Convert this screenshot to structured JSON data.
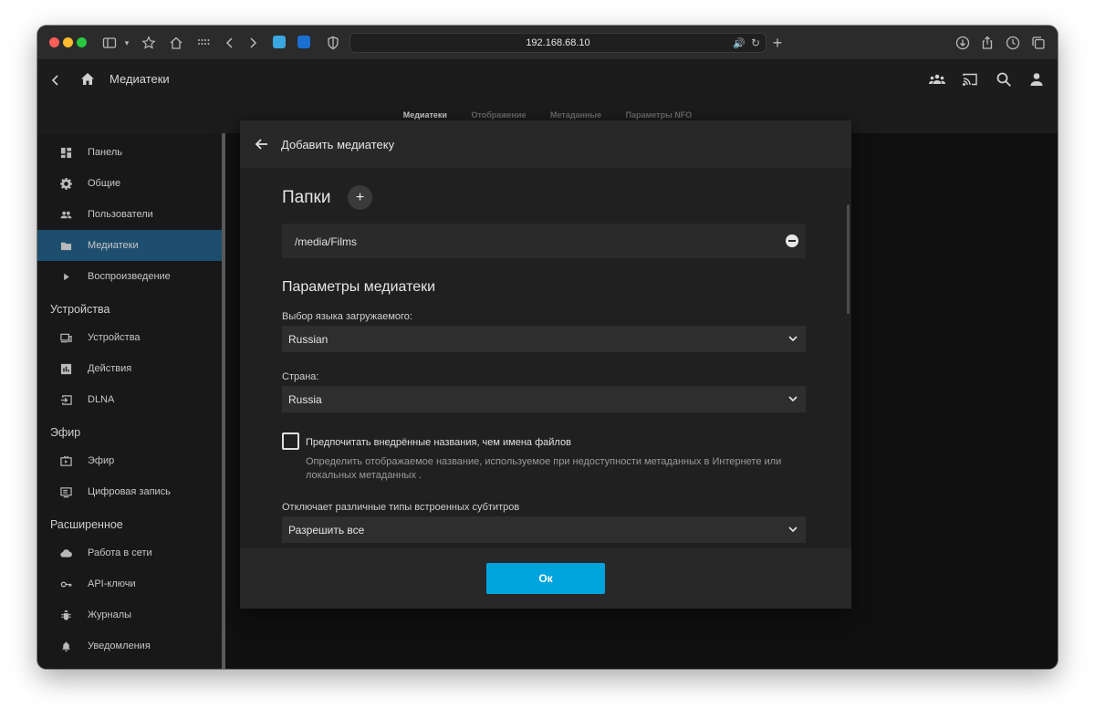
{
  "browser": {
    "url": "192.168.68.10"
  },
  "header": {
    "title": "Медиатеки",
    "tabs": [
      {
        "label": "Медиатеки",
        "active": true
      },
      {
        "label": "Отображение",
        "active": false
      },
      {
        "label": "Метаданные",
        "active": false
      },
      {
        "label": "Параметры NFO",
        "active": false
      }
    ]
  },
  "sidebar": {
    "items": [
      {
        "label": "Панель",
        "icon": "dashboard-icon"
      },
      {
        "label": "Общие",
        "icon": "gear-icon"
      },
      {
        "label": "Пользователи",
        "icon": "people-icon"
      },
      {
        "label": "Медиатеки",
        "icon": "folder-icon",
        "active": true
      },
      {
        "label": "Воспроизведение",
        "icon": "play-icon"
      }
    ],
    "sections": [
      {
        "title": "Устройства",
        "items": [
          {
            "label": "Устройства",
            "icon": "devices-icon"
          },
          {
            "label": "Действия",
            "icon": "activity-icon"
          },
          {
            "label": "DLNA",
            "icon": "input-icon"
          }
        ]
      },
      {
        "title": "Эфир",
        "items": [
          {
            "label": "Эфир",
            "icon": "live-tv-icon"
          },
          {
            "label": "Цифровая запись",
            "icon": "dvr-icon"
          }
        ]
      },
      {
        "title": "Расширенное",
        "items": [
          {
            "label": "Работа в сети",
            "icon": "cloud-icon"
          },
          {
            "label": "API-ключи",
            "icon": "key-icon"
          },
          {
            "label": "Журналы",
            "icon": "bug-icon"
          },
          {
            "label": "Уведомления",
            "icon": "bell-icon"
          }
        ]
      }
    ]
  },
  "dialog": {
    "title": "Добавить медиатеку",
    "folders_title": "Папки",
    "add_symbol": "+",
    "folder_path": "/media/Films",
    "section_title": "Параметры медиатеки",
    "language_label": "Выбор языка загружаемого:",
    "language_value": "Russian",
    "country_label": "Страна:",
    "country_value": "Russia",
    "checkbox_label": "Предпочитать внедрённые названия, чем имена файлов",
    "checkbox_checked": false,
    "checkbox_help": "Определить отображаемое название, используемое при недоступности метаданных в Интернете или локальных метаданных .",
    "subtitles_label": "Отключает различные типы встроенных субтитров",
    "subtitles_value": "Разрешить все",
    "ok_label": "Ок"
  },
  "colors": {
    "accent": "#00a4dc",
    "sidebar_active": "#1d4e6e"
  }
}
